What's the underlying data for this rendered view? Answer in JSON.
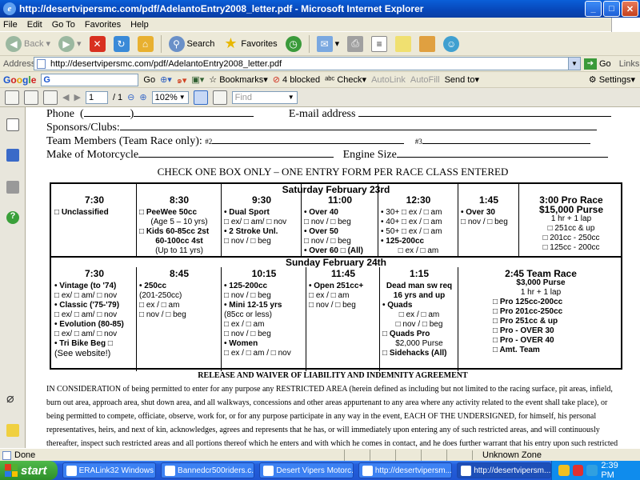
{
  "window": {
    "title": "http://desertvipersmc.com/pdf/AdelantoEntry2008_letter.pdf - Microsoft Internet Explorer"
  },
  "menu": [
    "File",
    "Edit",
    "Go To",
    "Favorites",
    "Help"
  ],
  "toolbar": {
    "back": "Back",
    "search": "Search",
    "favorites": "Favorites"
  },
  "address": {
    "label": "Address",
    "url": "http://desertvipersmc.com/pdf/AdelantoEntry2008_letter.pdf",
    "go": "Go",
    "links": "Links"
  },
  "google": {
    "go": "Go",
    "bookmarks": "Bookmarks",
    "blocked": "4 blocked",
    "check": "Check",
    "autolink": "AutoLink",
    "autofill": "AutoFill",
    "sendto": "Send to",
    "settings": "Settings"
  },
  "pdf": {
    "page": "1",
    "of": "/ 1",
    "zoom": "102%",
    "find": "Find"
  },
  "form": {
    "phone": "Phone",
    "email": "E-mail address",
    "sponsors": "Sponsors/Clubs:",
    "team": "Team Members (Team Race only):",
    "n2": "#2",
    "n3": "#3",
    "make": "Make of Motorcycle",
    "engine": "Engine Size",
    "check": "CHECK ONE BOX ONLY – ONE ENTRY FORM PER RACE CLASS ENTERED"
  },
  "saturday": {
    "label": "Saturday February 23rd",
    "cols": [
      {
        "time": "7:30",
        "lines": [
          "□ Unclassified"
        ]
      },
      {
        "time": "8:30",
        "lines": [
          "□ PeeWee 50cc",
          "(Age 5 – 10 yrs)",
          "□ Kids 60-85cc 2st",
          "60-100cc 4st",
          "(Up to 11 yrs)"
        ]
      },
      {
        "time": "9:30",
        "lines": [
          "• Dual Sport",
          "□ ex/ □ am/ □ nov",
          "• 2 Stroke Unl.",
          "□ nov / □ beg"
        ]
      },
      {
        "time": "11:00",
        "lines": [
          "• Over 40",
          "□ nov / □ beg",
          "• Over 50",
          "□ nov / □ beg",
          "• Over 60 □ (All)"
        ]
      },
      {
        "time": "12:30",
        "lines": [
          "• 30+ □ ex / □ am",
          "• 40+ □ ex / □ am",
          "• 50+ □ ex / □ am",
          "• 125-200cc",
          "□ ex / □ am"
        ]
      },
      {
        "time": "1:45",
        "lines": [
          "• Over 30",
          "□ nov / □ beg"
        ]
      },
      {
        "time": "3:00 Pro Race",
        "lines": [
          "$15,000 Purse",
          "1 hr + 1 lap",
          "□ 251cc & up",
          "□ 201cc - 250cc",
          "□ 125cc - 200cc"
        ]
      }
    ]
  },
  "sunday": {
    "label": "Sunday February 24th",
    "cols": [
      {
        "time": "7:30",
        "lines": [
          "• Vintage (to '74)",
          "□ ex/ □ am/ □ nov",
          "• Classic ('75-'79)",
          "□ ex/ □ am/ □ nov",
          "• Evolution (80-85)",
          "□ ex/ □ am/ □ nov",
          "• Tri Bike Beg □",
          "(See website!)"
        ]
      },
      {
        "time": "8:45",
        "lines": [
          "• 250cc",
          "(201-250cc)",
          "□ ex / □ am",
          "□ nov / □ beg"
        ]
      },
      {
        "time": "10:15",
        "lines": [
          "• 125-200cc",
          "□ nov / □ beg",
          "• Mini 12-15 yrs",
          "(85cc or less)",
          "□ ex / □ am",
          "□ nov / □ beg",
          "• Women",
          "□ ex / □ am / □ nov"
        ]
      },
      {
        "time": "11:45",
        "lines": [
          "• Open 251cc+",
          "□ ex / □ am",
          "□ nov / □ beg"
        ]
      },
      {
        "time": "1:15",
        "lines": [
          "Dead man sw req",
          "16 yrs and up",
          "• Quads",
          "□ ex / □ am",
          "□ nov / □ beg",
          "□ Quads Pro",
          "$2,000 Purse",
          "□ Sidehacks (All)"
        ]
      },
      {
        "time": "2:45 Team Race",
        "lines": [
          "$3,000 Purse",
          "1 hr + 1 lap",
          "□ Pro 125cc-200cc",
          "□ Pro 201cc-250cc",
          "□ Pro 251cc & up",
          "□ Pro - OVER 30",
          "□ Pro - OVER 40",
          "□ Amt. Team"
        ]
      }
    ]
  },
  "release": {
    "title": "RELEASE AND WAIVER OF LIABILITY AND INDEMNITY AGREEMENT",
    "text": "IN CONSIDERATION of being permitted to enter for any purpose any RESTRICTED AREA (herein defined as including but not limited to the racing surface, pit areas, infield, burn out area, approach area, shut down area, and all walkways, concessions and other areas appurtenant to any area where any activity related to the event shall take place), or being permitted to compete, officiate, observe, work for, or for any purpose participate in any way in the event, EACH OF THE UNDERSIGNED, for himself, his personal representatives, heirs, and next of kin, acknowledges, agrees and represents that he has, or will immediately upon entering any of such restricted areas, and will continuously thereafter, inspect such restricted areas and all portions thereof which he enters and with which he comes in contact, and he does further warrant that his entry upon such restricted"
  },
  "status": {
    "text": "Done",
    "zone": "Unknown Zone"
  },
  "taskbar": {
    "start": "start",
    "tasks": [
      "ERALink32 Windows ...",
      "Bannedcr500riders.c...",
      "Desert Vipers Motorc...",
      "http://desertvipersm...",
      "http://desertvipersm..."
    ],
    "time": "2:39 PM"
  },
  "colors": {
    "xp_blue": "#0A5FD8",
    "start_green": "#2e8f2a",
    "page_bg": "#ECE9D8"
  }
}
